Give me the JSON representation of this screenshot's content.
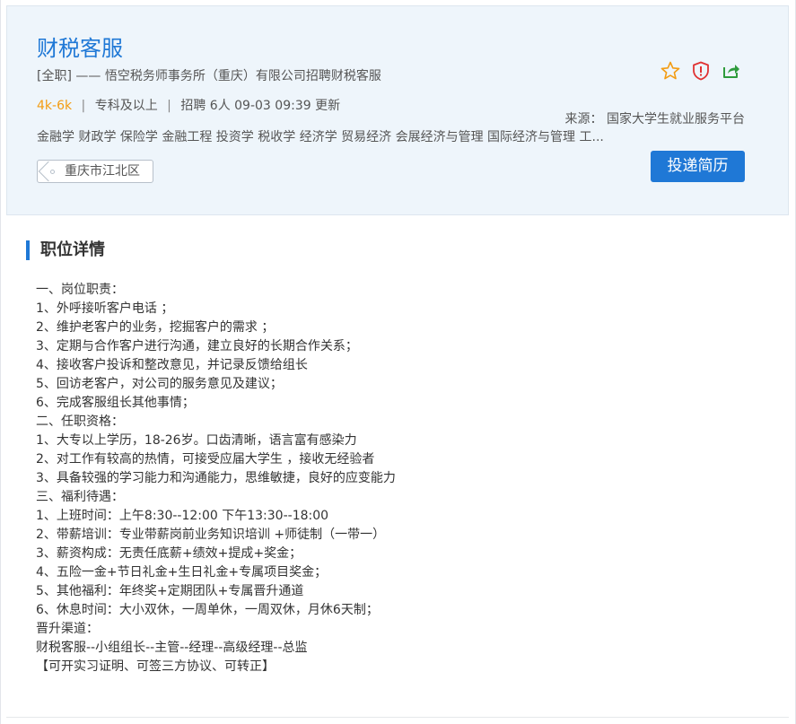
{
  "job": {
    "title": "财税客服",
    "subtitle": "[全职]  ——  悟空税务师事务所（重庆）有限公司招聘财税客服",
    "salary": "4k-6k",
    "separator": "|",
    "education": "专科及以上",
    "recruit": "招聘 6人  09-03 09:39 更新",
    "majors": "金融学 财政学 保险学 金融工程 投资学 税收学 经济学 贸易经济 会展经济与管理 国际经济与管理 工...",
    "location": "重庆市江北区",
    "source": "来源： 国家大学生就业服务平台",
    "apply_label": "投递简历"
  },
  "icons": {
    "favorite": "star-icon",
    "report": "shield-alert-icon",
    "share": "share-icon"
  },
  "colors": {
    "brand": "#1f78d6",
    "salary": "#f39c12",
    "report": "#e03232",
    "share": "#2e9b3c"
  },
  "details": {
    "title": "职位详情",
    "lines": [
      "一、岗位职责：",
      "1、外呼接听客户电话 ；",
      "2、维护老客户的业务，挖掘客户的需求 ；",
      "3、定期与合作客户进行沟通，建立良好的长期合作关系；",
      "4、接收客户投诉和整改意见，并记录反馈给组长",
      "5、回访老客户，对公司的服务意见及建议；",
      "6、完成客服组长其他事情；",
      "二、任职资格：",
      "1、大专以上学历，18-26岁。口齿清晰，语言富有感染力",
      "2、对工作有较高的热情，可接受应届大学生 ，接收无经验者",
      "3、具备较强的学习能力和沟通能力，思维敏捷，良好的应变能力",
      "三、福利待遇：",
      "1、上班时间：上午8:30--12:00  下午13:30--18:00",
      "2、带薪培训：专业带薪岗前业务知识培训 +师徒制（一带一）",
      "3、薪资构成：无责任底薪+绩效+提成+奖金；",
      "4、五险一金+节日礼金+生日礼金+专属项目奖金；",
      "5、其他福利：年终奖+定期团队+专属晋升通道",
      "6、休息时间：大小双休，一周单休，一周双休，月休6天制；",
      "晋升渠道：",
      "财税客服--小组组长--主管--经理--高级经理--总监",
      "【可开实习证明、可签三方协议、可转正】"
    ]
  }
}
